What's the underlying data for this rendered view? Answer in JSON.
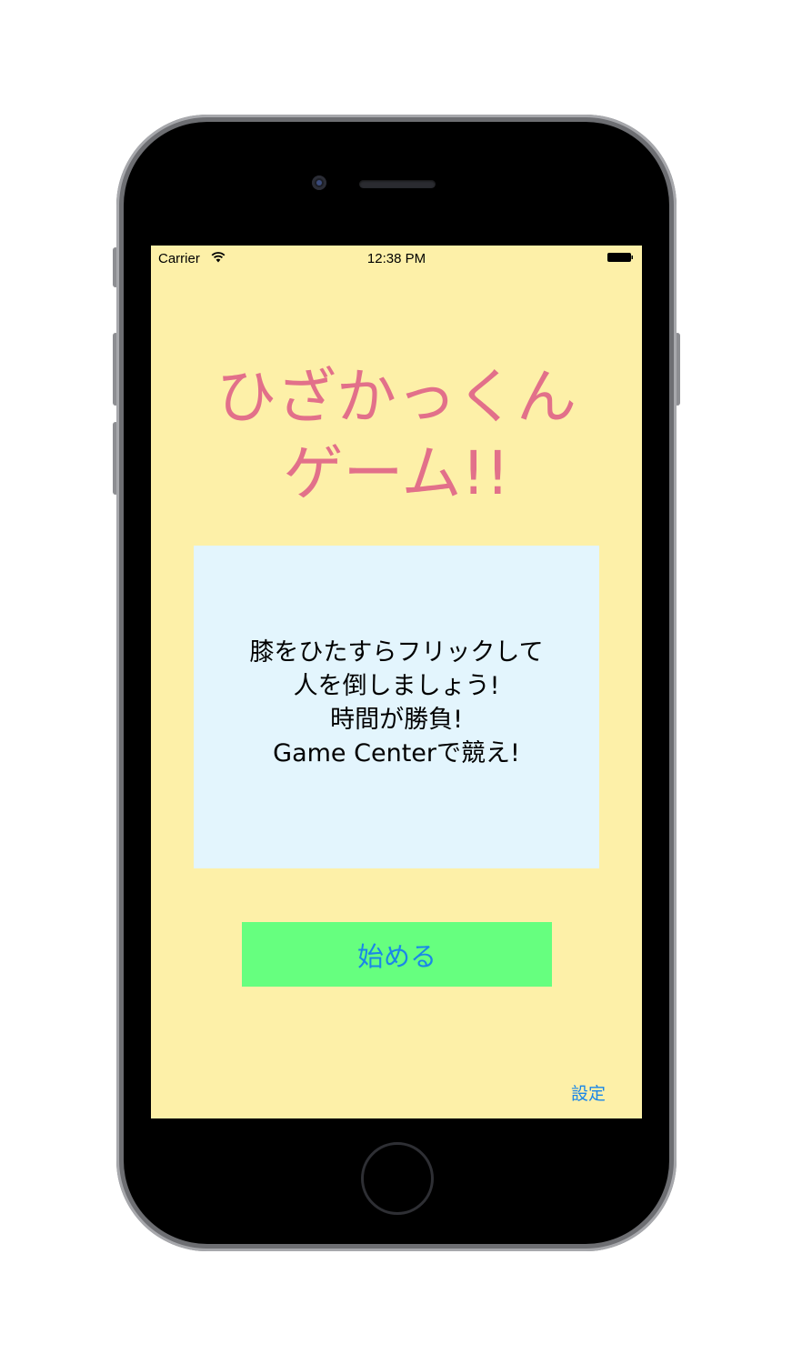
{
  "status_bar": {
    "carrier": "Carrier",
    "time": "12:38 PM"
  },
  "title": {
    "line1": "ひざかっくん",
    "line2": "ゲーム!!"
  },
  "description": {
    "lines": [
      "膝をひたすらフリックして",
      "人を倒しましょう!",
      "時間が勝負!",
      "Game Centerで競え!"
    ]
  },
  "start_button_label": "始める",
  "settings_label": "設定",
  "colors": {
    "screen_background": "#fdf0a8",
    "title_color": "#e2708a",
    "description_background": "#e3f5fd",
    "button_background": "#66ff7f",
    "link_color": "#1a86e8"
  },
  "icons": {
    "wifi": "wifi-icon",
    "battery": "battery-icon"
  }
}
